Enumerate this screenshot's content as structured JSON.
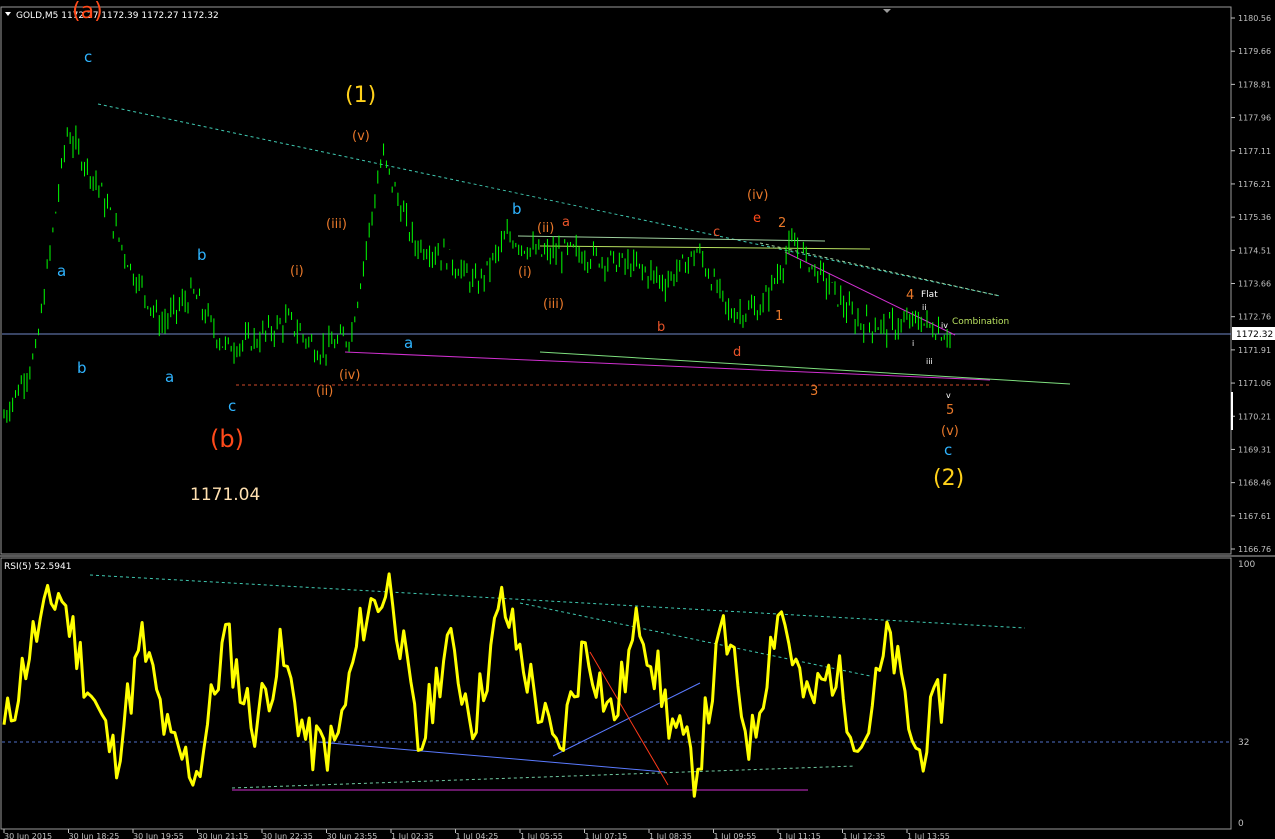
{
  "header": {
    "symbol_line": "GOLD,M5  1172.27 1172.39 1172.27 1172.32",
    "rsi_line": "RSI(5) 52.5941"
  },
  "colors": {
    "background": "#000000",
    "candle": "#00ff00",
    "rsi_line": "#ffff00",
    "axis": "#c0c0c0",
    "price_line": "#6f88c8",
    "wave_blue": "#2fb4ff",
    "wave_orange": "#e8782a",
    "wave_yellow": "#ffd11a",
    "wave_red": "#ff4a1a",
    "trend_magenta": "#d030d0",
    "trend_green": "#7fe07f"
  },
  "price_axis": {
    "labels": [
      "1180.56",
      "1179.66",
      "1178.81",
      "1177.96",
      "1177.11",
      "1176.21",
      "1175.36",
      "1174.51",
      "1173.66",
      "1172.76",
      "1171.91",
      "1171.06",
      "1170.21",
      "1169.31",
      "1168.46",
      "1167.61",
      "1166.76"
    ],
    "current_price": "1172.32"
  },
  "rsi_axis": {
    "labels": [
      "100",
      "32",
      "0"
    ]
  },
  "time_axis": {
    "labels": [
      "30 Jun 2015",
      "30 Jun 18:25",
      "30 Jun 19:55",
      "30 Jun 21:15",
      "30 Jun 22:35",
      "30 Jun 23:55",
      "1 Jul 02:35",
      "1 Jul 04:25",
      "1 Jul 05:55",
      "1 Jul 07:15",
      "1 Jul 08:35",
      "1 Jul 09:55",
      "1 Jul 11:15",
      "1 Jul 12:35",
      "1 Jul 13:55"
    ]
  },
  "annotations": {
    "low_value": "1171.04",
    "wave_a_top": "(a)",
    "wave_b_big": "(b)",
    "wave_1": "(1)",
    "wave_2": "(2)",
    "flat": "Flat",
    "combination": "Combination",
    "blue_labels": [
      "c",
      "a",
      "b",
      "b",
      "a",
      "c",
      "a",
      "b",
      "c"
    ],
    "orange_labels": [
      "(v)",
      "(iii)",
      "(i)",
      "(ii)",
      "(iv)",
      "(ii)",
      "a",
      "(i)",
      "(iii)",
      "(iv)",
      "e",
      "2",
      "c",
      "b",
      "d",
      "1",
      "3",
      "4",
      "5",
      "(v)"
    ],
    "small_labels": [
      "ii",
      "i",
      "iii",
      "iv",
      "v"
    ]
  },
  "chart_data": [
    {
      "type": "line",
      "title": "GOLD,M5",
      "series": [
        {
          "name": "GOLD,M5",
          "note_values_close": [
            1170.2,
            1171.8,
            1177.6,
            1176.2,
            1174.1,
            1172.6,
            1173.4,
            1172.0,
            1172.2,
            1172.7,
            1171.9,
            1172.3,
            1177.0,
            1174.7,
            1174.4,
            1173.6,
            1174.9,
            1174.4,
            1174.5,
            1174.3,
            1174.1,
            1173.7,
            1174.5,
            1172.9,
            1173.0,
            1174.7,
            1173.8,
            1172.7,
            1172.5,
            1172.7,
            1172.3
          ]
        }
      ],
      "ylim": [
        1166.76,
        1180.56
      ],
      "current_price": 1172.32,
      "low": 1171.04
    },
    {
      "type": "line",
      "title": "RSI(5)",
      "series": [
        {
          "name": "RSI(5)",
          "values": [
            35,
            70,
            90,
            55,
            25,
            70,
            30,
            20,
            72,
            38,
            65,
            30,
            30,
            80,
            92,
            28,
            70,
            40,
            85,
            55,
            25,
            70,
            40,
            80,
            42,
            20,
            75,
            30,
            85,
            45,
            60,
            30,
            72,
            25,
            52.59
          ]
        }
      ],
      "ylim": [
        0,
        100
      ],
      "level": 32,
      "last_value": 52.5941
    }
  ]
}
